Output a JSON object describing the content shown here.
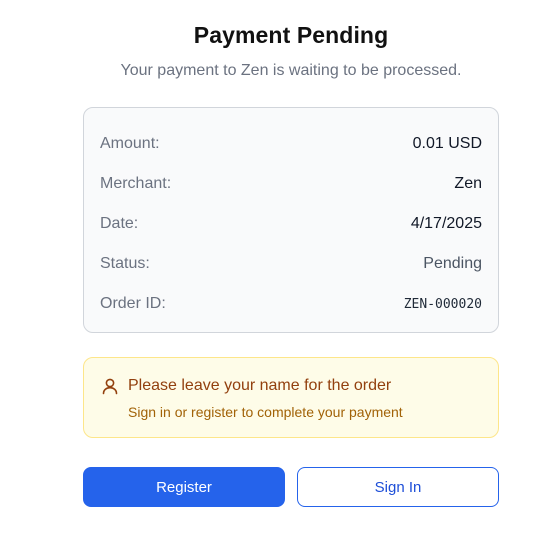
{
  "header": {
    "title": "Payment Pending",
    "subtitle": "Your payment to Zen is waiting to be processed."
  },
  "details": [
    {
      "label": "Amount:",
      "value": "0.01 USD"
    },
    {
      "label": "Merchant:",
      "value": "Zen"
    },
    {
      "label": "Date:",
      "value": "4/17/2025"
    },
    {
      "label": "Status:",
      "value": "Pending"
    },
    {
      "label": "Order ID:",
      "value": "ZEN-000020"
    }
  ],
  "notice": {
    "icon": "user-icon",
    "heading": "Please leave your name for the order",
    "text": "Sign in or register to complete your payment"
  },
  "actions": {
    "register_label": "Register",
    "signin_label": "Sign In"
  },
  "colors": {
    "primary": "#2563eb",
    "notice_bg": "#fefce8",
    "notice_border": "#fde68a",
    "notice_text": "#92400e"
  }
}
